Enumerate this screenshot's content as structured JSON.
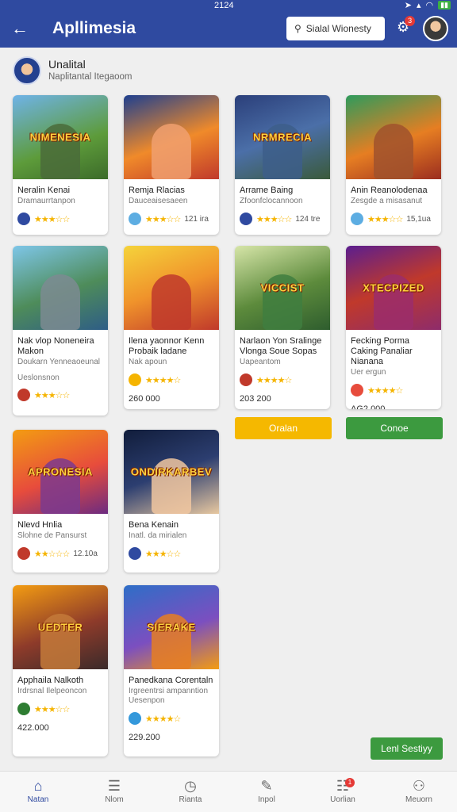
{
  "status": {
    "time": "2124"
  },
  "appbar": {
    "title": "Apllimesia",
    "search_placeholder": "Sialal Wionesty",
    "notif_count": "3"
  },
  "profile": {
    "name": "Unalital",
    "subtitle": "Naplitantal Itegaoom"
  },
  "cards": [
    {
      "art": "NIMENESIA",
      "name": "Neralin Kenai",
      "sub": "Dramaurrtanpon",
      "meta": "",
      "rating": 2.5,
      "price": ""
    },
    {
      "art": "",
      "name": "Remja Rlacias",
      "sub": "Dauceaisesaeen",
      "meta": "",
      "rating": 3,
      "price": "121 ira"
    },
    {
      "art": "NRMRECIA",
      "name": "Arrame Baing",
      "sub": "Zfoonfclocannoon",
      "meta": "",
      "rating": 3,
      "price": "124 tre"
    },
    {
      "art": "",
      "name": "Anin Reanolodenaa",
      "sub": "Zesgde a misasanut",
      "meta": "",
      "rating": 3,
      "price": "15,1ua"
    },
    {
      "art": "",
      "name": "Nak vlop Noneneira Makon",
      "sub": "Doukarn Yenneaoeunal",
      "meta": "Ueslonsnon",
      "rating": 2.5,
      "price": ""
    },
    {
      "art": "",
      "name": "Ilena yaonnor Kenn Probaik ladane",
      "sub": "Nak apoun",
      "meta": "",
      "rating": 4,
      "price": "260 000"
    },
    {
      "art": "VICCIST",
      "name": "Narlaon Yon Sralinge Vlonga Soue Sopas",
      "sub": "Uapeantom",
      "meta": "",
      "rating": 4,
      "price": "203 200"
    },
    {
      "art": "XTECPIZED",
      "name": "Fecking Porma Caking Panaliar Nianana",
      "sub": "Uer ergun",
      "meta": "",
      "rating": 4,
      "price": "AG2 000"
    },
    {
      "art": "APRONESIA",
      "name": "Nlevd Hnlia",
      "sub": "Slohne de Pansurst",
      "meta": "",
      "rating": 2,
      "price": "12.10a"
    },
    {
      "art": "ONDIRKARBEV",
      "name": "Bena Kenain",
      "sub": "Inatl. da mirialen",
      "meta": "",
      "rating": 3,
      "price": ""
    },
    {
      "art": "UEDTER",
      "name": "Apphaila Nalkoth",
      "sub": "Irdrsnal Ilelpeoncon",
      "meta": "",
      "rating": 3,
      "price": "422.000"
    },
    {
      "art": "SIERAKE",
      "name": "Panedkana Corentaln",
      "sub": "Irgreentrsi ampanntion Uesenpon",
      "meta": "",
      "rating": 4,
      "price": "229.200"
    }
  ],
  "buttons": {
    "orange": "Oralan",
    "green": "Conoe",
    "bottom": "Lenl Sestiyy"
  },
  "nav": [
    {
      "label": "Natan",
      "icon": "home-icon"
    },
    {
      "label": "Nlom",
      "icon": "list-icon"
    },
    {
      "label": "Rianta",
      "icon": "clock-icon"
    },
    {
      "label": "Inpol",
      "icon": "pen-icon"
    },
    {
      "label": "Uorlian",
      "icon": "inbox-icon",
      "badge": "1"
    },
    {
      "label": "Meuorn",
      "icon": "user-icon"
    }
  ],
  "colors": {
    "primary": "#2f4aa0",
    "orange": "#f5b800",
    "green": "#3c9a3f",
    "star": "#f5b400"
  }
}
